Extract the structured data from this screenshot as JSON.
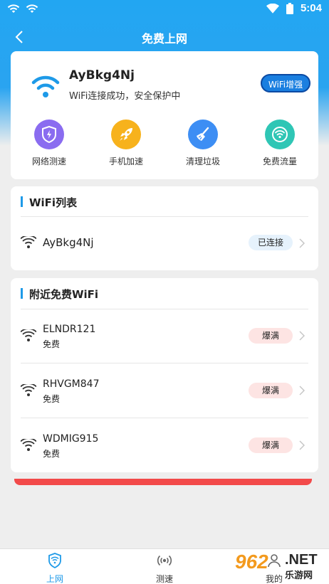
{
  "status": {
    "time": "5:04"
  },
  "nav": {
    "title": "免费上网"
  },
  "current": {
    "ssid": "AyBkg4Nj",
    "status_text": "WiFi连接成功，安全保护中",
    "boost_label": "WiFi增强"
  },
  "tools": [
    {
      "label": "网络测速",
      "icon": "speed-shield-icon",
      "color": "#8a6cf0"
    },
    {
      "label": "手机加速",
      "icon": "rocket-icon",
      "color": "#f7b21c"
    },
    {
      "label": "清理垃圾",
      "icon": "broom-icon",
      "color": "#3d8ef4"
    },
    {
      "label": "免费流量",
      "icon": "wifi-circle-icon",
      "color": "#2fc6b5"
    }
  ],
  "wifi_list": {
    "title": "WiFi列表",
    "items": [
      {
        "name": "AyBkg4Nj",
        "tag": "已连接"
      }
    ]
  },
  "nearby": {
    "title": "附近免费WiFi",
    "items": [
      {
        "name": "ELNDR121",
        "sub": "免费",
        "tag": "爆满"
      },
      {
        "name": "RHVGM847",
        "sub": "免费",
        "tag": "爆满"
      },
      {
        "name": "WDMIG915",
        "sub": "免费",
        "tag": "爆满"
      }
    ]
  },
  "tabs": [
    {
      "label": "上网",
      "active": true
    },
    {
      "label": "测速",
      "active": false
    },
    {
      "label": "我的",
      "active": false
    }
  ],
  "watermark": {
    "num": "962",
    "net": ".NET",
    "cn": "乐游网"
  },
  "colors": {
    "primary": "#22a6f2",
    "accent_blue": "#1a7fe0",
    "danger": "#f24a4a"
  }
}
